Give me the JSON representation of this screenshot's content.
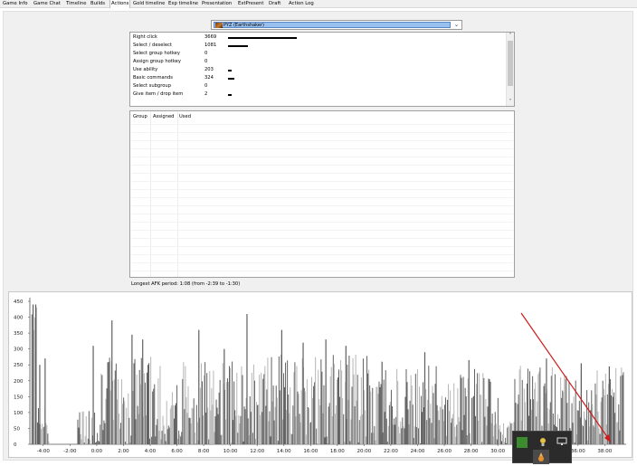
{
  "tabs": [
    "Game Info",
    "Game Chat",
    "Timeline",
    "Builds",
    "Actions",
    "Gold timeline",
    "Exp timeline",
    "Presentation",
    "ExtPresent",
    "Draft",
    "Action Log"
  ],
  "active_tab": "Actions",
  "player_select": {
    "value": "PYZ (Earthshaker)"
  },
  "actions": [
    {
      "label": "Right click",
      "count": "3669",
      "bar": 3669
    },
    {
      "label": "Select / deselect",
      "count": "1081",
      "bar": 1081
    },
    {
      "label": "Select group hotkey",
      "count": "0",
      "bar": 0
    },
    {
      "label": "Assign group hotkey",
      "count": "0",
      "bar": 0
    },
    {
      "label": "Use ability",
      "count": "203",
      "bar": 203
    },
    {
      "label": "Basic commands",
      "count": "324",
      "bar": 324
    },
    {
      "label": "Select subgroup",
      "count": "0",
      "bar": 0
    },
    {
      "label": "Give item / drop item",
      "count": "2",
      "bar": 2
    }
  ],
  "groups_table": {
    "headers": [
      "Group",
      "Assigned",
      "Used"
    ],
    "rows": []
  },
  "afk_text": "Longest AFK period: 1:08 (from -2:39 to -1:30)",
  "colors": {
    "bar_dark": "#5f5f5f",
    "bar_light": "#b4b4b4",
    "arrow": "#d0191a",
    "selection": "#98c0ef"
  },
  "chart_data": {
    "type": "bar",
    "y_ticks": [
      "450",
      "400",
      "350",
      "300",
      "250",
      "200",
      "150",
      "100",
      "50",
      "0"
    ],
    "ylim": [
      0,
      450
    ],
    "x_ticks": [
      "-4:00",
      "-2:00",
      "0:00",
      "2:00",
      "4:00",
      "6:00",
      "8:00",
      "10:00",
      "12:00",
      "14:00",
      "16:00",
      "18:00",
      "20:00",
      "22:00",
      "24:00",
      "26:00",
      "28:00",
      "30:00",
      "32:00",
      "34:00",
      "36:00",
      "38:00"
    ],
    "xlim_minutes": [
      -5.0,
      39.6
    ],
    "segments": [
      {
        "from": -4.9,
        "to": -4.5,
        "level": 410,
        "spread": 60
      },
      {
        "from": -4.5,
        "to": -3.6,
        "level": 70,
        "spread": 50
      },
      {
        "from": -3.6,
        "to": -1.5,
        "level": 0,
        "spread": 0
      },
      {
        "from": -1.5,
        "to": 0.2,
        "level": 60,
        "spread": 60
      },
      {
        "from": 0.2,
        "to": 4.8,
        "level": 170,
        "spread": 110
      },
      {
        "from": 4.8,
        "to": 6.2,
        "level": 130,
        "spread": 100
      },
      {
        "from": 6.2,
        "to": 12.5,
        "level": 165,
        "spread": 100
      },
      {
        "from": 12.5,
        "to": 20.5,
        "level": 175,
        "spread": 110
      },
      {
        "from": 20.5,
        "to": 30.0,
        "level": 150,
        "spread": 100
      },
      {
        "from": 30.0,
        "to": 31.2,
        "level": 40,
        "spread": 35
      },
      {
        "from": 31.2,
        "to": 39.4,
        "level": 150,
        "spread": 100
      }
    ],
    "peaks": [
      {
        "t": -4.8,
        "v": 440
      },
      {
        "t": -4.6,
        "v": 440
      },
      {
        "t": -3.9,
        "v": 270
      },
      {
        "t": -4.3,
        "v": 250
      },
      {
        "t": -0.3,
        "v": 310
      },
      {
        "t": 1.1,
        "v": 390
      },
      {
        "t": 2.6,
        "v": 345
      },
      {
        "t": 3.4,
        "v": 330
      },
      {
        "t": 7.6,
        "v": 360
      },
      {
        "t": 9.5,
        "v": 300
      },
      {
        "t": 11.2,
        "v": 410
      },
      {
        "t": 13.8,
        "v": 360
      },
      {
        "t": 15.4,
        "v": 320
      },
      {
        "t": 17.1,
        "v": 330
      },
      {
        "t": 18.6,
        "v": 310
      },
      {
        "t": 21.3,
        "v": 260
      },
      {
        "t": 24.5,
        "v": 290
      },
      {
        "t": 27.8,
        "v": 265
      },
      {
        "t": 33.6,
        "v": 270
      },
      {
        "t": 36.2,
        "v": 255
      },
      {
        "t": 38.3,
        "v": 245
      }
    ],
    "x_labels_visible": true,
    "grid": false
  }
}
